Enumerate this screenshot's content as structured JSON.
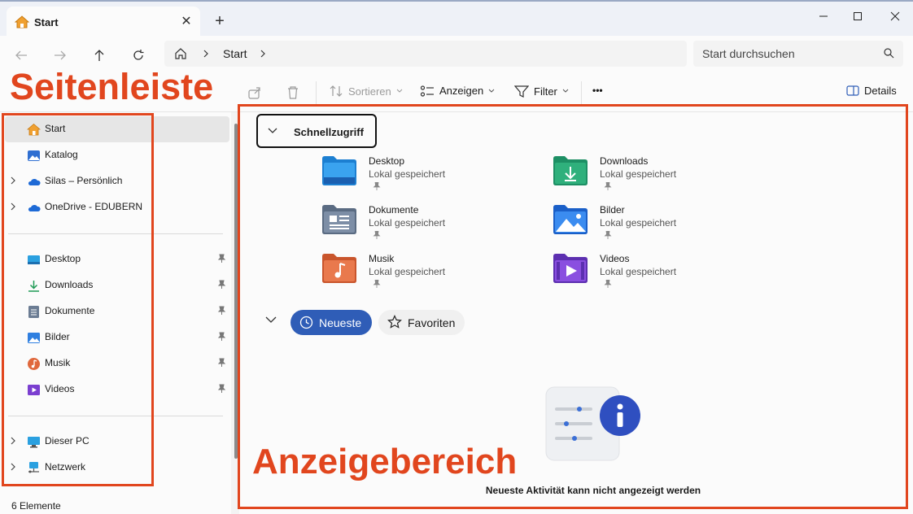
{
  "tab": {
    "title": "Start",
    "close": "✕",
    "new": "+"
  },
  "window": {
    "minimize": "—",
    "maximize": "☐",
    "close": "✕"
  },
  "nav": {
    "address_label": "Start",
    "search_placeholder": "Start durchsuchen"
  },
  "toolbar": {
    "sort": "Sortieren",
    "view": "Anzeigen",
    "filter": "Filter",
    "more": "•••",
    "details": "Details"
  },
  "sidebar": {
    "top_items": [
      {
        "label": "Start",
        "icon": "home-icon",
        "selected": true,
        "expandable": false
      },
      {
        "label": "Katalog",
        "icon": "gallery-icon",
        "expandable": false
      },
      {
        "label": "Silas – Persönlich",
        "icon": "onedrive-icon",
        "expandable": true
      },
      {
        "label": "OneDrive - EDUBERN",
        "icon": "onedrive-icon",
        "expandable": true
      }
    ],
    "pinned_items": [
      {
        "label": "Desktop",
        "icon": "desktop-icon"
      },
      {
        "label": "Downloads",
        "icon": "download-icon"
      },
      {
        "label": "Dokumente",
        "icon": "documents-icon"
      },
      {
        "label": "Bilder",
        "icon": "pictures-icon"
      },
      {
        "label": "Musik",
        "icon": "music-icon"
      },
      {
        "label": "Videos",
        "icon": "videos-icon"
      }
    ],
    "bottom_items": [
      {
        "label": "Dieser PC",
        "icon": "this-pc-icon"
      },
      {
        "label": "Netzwerk",
        "icon": "network-icon"
      }
    ]
  },
  "status": {
    "count": "6 Elemente"
  },
  "main": {
    "quick_access_title": "Schnellzugriff",
    "quick_items": [
      {
        "name": "Desktop",
        "sub": "Lokal gespeichert",
        "icon": "desktop-folder-icon"
      },
      {
        "name": "Downloads",
        "sub": "Lokal gespeichert",
        "icon": "downloads-folder-icon"
      },
      {
        "name": "Dokumente",
        "sub": "Lokal gespeichert",
        "icon": "documents-folder-icon"
      },
      {
        "name": "Bilder",
        "sub": "Lokal gespeichert",
        "icon": "pictures-folder-icon"
      },
      {
        "name": "Musik",
        "sub": "Lokal gespeichert",
        "icon": "music-folder-icon"
      },
      {
        "name": "Videos",
        "sub": "Lokal gespeichert",
        "icon": "videos-folder-icon"
      }
    ],
    "recent_tab": "Neueste",
    "favorites_tab": "Favoriten",
    "empty_message": "Neueste Aktivität kann nicht angezeigt werden"
  },
  "annotations": {
    "sidebar_label": "Seitenleiste",
    "main_label": "Anzeigebereich"
  },
  "colors": {
    "accent": "#2f5db7",
    "annotation": "#e1461e"
  }
}
